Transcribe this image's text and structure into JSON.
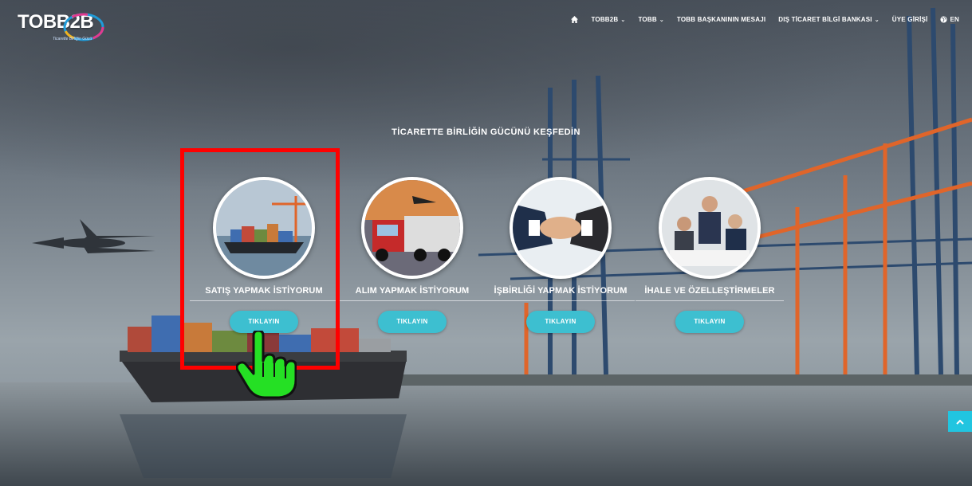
{
  "logo": {
    "text": "TOBB2B",
    "slogan": "Ticarette Birliğin Gücü"
  },
  "nav": {
    "items": [
      {
        "label": "TOBB2B",
        "dropdown": true
      },
      {
        "label": "TOBB",
        "dropdown": true
      },
      {
        "label": "TOBB BAŞKANININ MESAJI",
        "dropdown": false
      },
      {
        "label": "DIŞ TİCARET BİLGİ BANKASI",
        "dropdown": true
      },
      {
        "label": "ÜYE GİRİŞİ",
        "dropdown": false
      },
      {
        "label": "EN",
        "dropdown": false
      }
    ]
  },
  "heading": "TİCARETTE BİRLİĞİN GÜCÜNÜ KEŞFEDİN",
  "cards": [
    {
      "label": "SATIŞ YAPMAK İSTİYORUM",
      "button": "TIKLAYIN"
    },
    {
      "label": "ALIM YAPMAK İSTİYORUM",
      "button": "TIKLAYIN"
    },
    {
      "label": "İŞBİRLİĞİ YAPMAK İSTİYORUM",
      "button": "TIKLAYIN"
    },
    {
      "label": "İHALE VE ÖZELLEŞTİRMELER",
      "button": "TIKLAYIN"
    }
  ],
  "colors": {
    "accent": "#3dbfd0",
    "highlight": "#ff0000",
    "scroll_top": "#21c5e0"
  },
  "icons": {
    "home": "home-icon",
    "globe": "globe-icon",
    "scroll_top": "chevron-up-icon",
    "pointer": "hand-pointer-icon"
  }
}
